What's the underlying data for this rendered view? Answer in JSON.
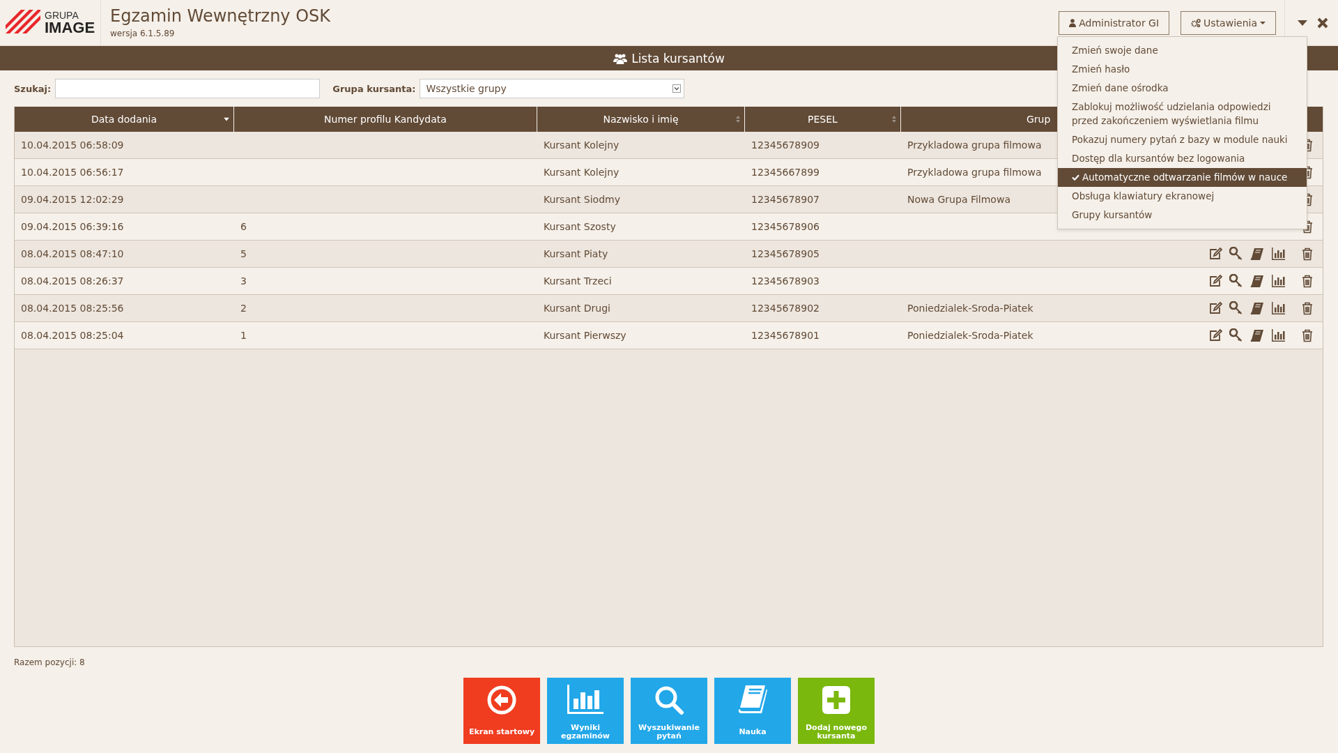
{
  "logo": {
    "line1": "GRUPA",
    "line2": "IMAGE"
  },
  "app": {
    "title": "Egzamin Wewnętrzny OSK",
    "version": "wersja 6.1.5.89"
  },
  "user_button": {
    "label": "Administrator GI"
  },
  "settings_button": {
    "label": "Ustawienia"
  },
  "settings_menu": [
    {
      "label": "Zmień swoje dane",
      "checked": false
    },
    {
      "label": "Zmień hasło",
      "checked": false
    },
    {
      "label": "Zmień dane ośrodka",
      "checked": false
    },
    {
      "label": "Zablokuj możliwość udzielania odpowiedzi przed zakończeniem wyświetlania filmu",
      "checked": false
    },
    {
      "label": "Pokazuj numery pytań z bazy w module nauki",
      "checked": false
    },
    {
      "label": "Dostęp dla kursantów bez logowania",
      "checked": false
    },
    {
      "label": "Automatyczne odtwarzanie filmów w nauce",
      "checked": true
    },
    {
      "label": "Obsługa klawiatury ekranowej",
      "checked": false
    },
    {
      "label": "Grupy kursantów",
      "checked": false
    }
  ],
  "panel": {
    "title": "Lista kursantów"
  },
  "filters": {
    "search": {
      "label": "Szukaj:"
    },
    "group": {
      "label": "Grupa kursanta:",
      "value": "Wszystkie grupy"
    }
  },
  "table": {
    "columns": [
      {
        "label": "Data dodania",
        "sorted": true
      },
      {
        "label": "Numer profilu Kandydata",
        "sorted": false,
        "sortable": false
      },
      {
        "label": "Nazwisko i imię",
        "sorted": false,
        "sortable": true
      },
      {
        "label": "PESEL",
        "sorted": false,
        "sortable": true
      },
      {
        "label": "Grup"
      }
    ],
    "rows": [
      {
        "cells": [
          "10.04.2015 06:58:09",
          "",
          "Kursant Kolejny",
          "12345678909",
          "Przykladowa grupa filmowa"
        ],
        "actions": [
          {
            "kind": "delete"
          }
        ]
      },
      {
        "cells": [
          "10.04.2015 06:56:17",
          "",
          "Kursant Kolejny",
          "12345667899",
          "Przykladowa grupa filmowa"
        ],
        "actions": [
          {
            "kind": "delete"
          }
        ]
      },
      {
        "cells": [
          "09.04.2015 12:02:29",
          "",
          "Kursant Siodmy",
          "12345678907",
          "Nowa Grupa Filmowa"
        ],
        "actions": [
          {
            "kind": "delete"
          }
        ]
      },
      {
        "cells": [
          "09.04.2015 06:39:16",
          "6",
          "Kursant Szosty",
          "12345678906",
          ""
        ],
        "actions": [
          {
            "kind": "delete"
          }
        ]
      },
      {
        "cells": [
          "08.04.2015 08:47:10",
          "5",
          "Kursant Piaty",
          "12345678905",
          ""
        ],
        "actions": [
          {
            "kind": "edit"
          },
          {
            "kind": "key"
          },
          {
            "kind": "book"
          },
          {
            "kind": "chart"
          },
          {
            "kind": "delete"
          }
        ]
      },
      {
        "cells": [
          "08.04.2015 08:26:37",
          "3",
          "Kursant Trzeci",
          "12345678903",
          ""
        ],
        "actions": [
          {
            "kind": "edit"
          },
          {
            "kind": "key"
          },
          {
            "kind": "book"
          },
          {
            "kind": "chart"
          },
          {
            "kind": "delete"
          }
        ]
      },
      {
        "cells": [
          "08.04.2015 08:25:56",
          "2",
          "Kursant Drugi",
          "12345678902",
          "Poniedzialek-Sroda-Piatek"
        ],
        "actions": [
          {
            "kind": "edit"
          },
          {
            "kind": "key"
          },
          {
            "kind": "book"
          },
          {
            "kind": "chart"
          },
          {
            "kind": "delete"
          }
        ]
      },
      {
        "cells": [
          "08.04.2015 08:25:04",
          "1",
          "Kursant Pierwszy",
          "12345678901",
          "Poniedzialek-Sroda-Piatek"
        ],
        "actions": [
          {
            "kind": "edit"
          },
          {
            "kind": "key"
          },
          {
            "kind": "book"
          },
          {
            "kind": "chart"
          },
          {
            "kind": "delete"
          }
        ]
      }
    ]
  },
  "footer": {
    "total": "Razem pozycji: 8"
  },
  "tiles": [
    {
      "label": "Ekran startowy",
      "kind": "home"
    },
    {
      "label": "Wyniki egzaminów",
      "kind": "results"
    },
    {
      "label": "Wyszukiwanie pytań",
      "kind": "search"
    },
    {
      "label": "Nauka",
      "kind": "study"
    },
    {
      "label": "Dodaj nowego kursanta",
      "kind": "add"
    }
  ]
}
